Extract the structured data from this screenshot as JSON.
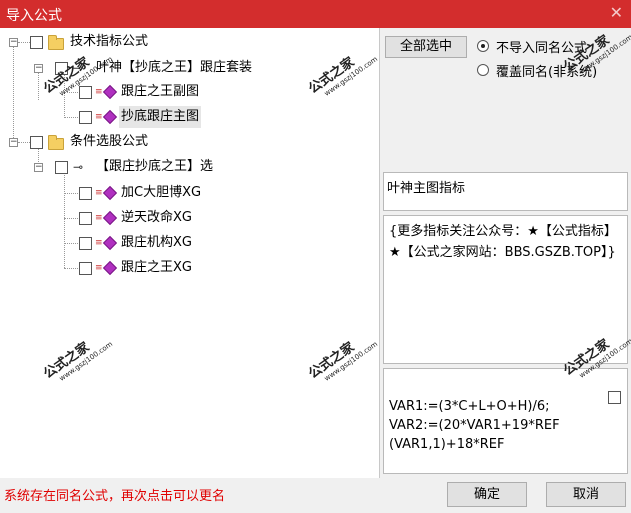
{
  "window": {
    "title": "导入公式",
    "close_glyph": "✕"
  },
  "tree": {
    "nodes": [
      {
        "label": "技术指标公式",
        "expander": "−"
      },
      {
        "label": "叶神【抄底之王】跟庄套装",
        "expander": "−"
      },
      {
        "label": "跟庄之王副图"
      },
      {
        "label": "抄底跟庄主图"
      },
      {
        "label": "条件选股公式",
        "expander": "−"
      },
      {
        "label": "【跟庄抄底之王】选",
        "expander": "−"
      },
      {
        "label": "加C大胆博XG"
      },
      {
        "label": "逆天改命XG"
      },
      {
        "label": "跟庄机构XG"
      },
      {
        "label": "跟庄之王XG"
      }
    ]
  },
  "watermark": {
    "text": "公式之家",
    "url": "www.gszj100.com"
  },
  "options": {
    "select_all_label": "全部选中",
    "radio_skip_label": "不导入同名公式",
    "radio_overwrite_label": "覆盖同名(非系统)",
    "selected": "skip"
  },
  "info": {
    "name": "叶神主图指标",
    "description": "{更多指标关注公众号：★【公式指标】★【公式之家网站：BBS.GSZB.TOP】}",
    "code": "VAR1:=(3*C+L+O+H)/6;\nVAR2:=(20*VAR1+19*REF\n(VAR1,1)+18*REF"
  },
  "footer": {
    "status": "系统存在同名公式，再次点击可以更名",
    "ok_label": "确定",
    "cancel_label": "取消"
  }
}
